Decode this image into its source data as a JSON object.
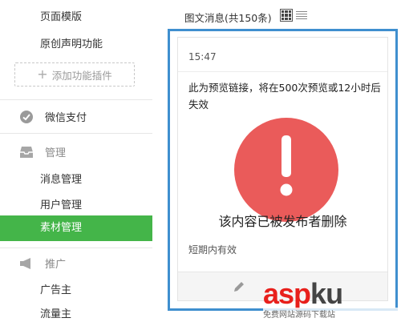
{
  "sidebar": {
    "page_template": "页面模版",
    "original_declaration": "原创声明功能",
    "add_plugin": "添加功能插件",
    "wechat_pay": "微信支付",
    "manage": {
      "heading": "管理",
      "items": [
        "消息管理",
        "用户管理",
        "素材管理"
      ]
    },
    "promote": {
      "heading": "推广",
      "items": [
        "广告主",
        "流量主"
      ]
    }
  },
  "materials": {
    "count_label": "图文消息(共150条)",
    "card": {
      "time": "15:47",
      "notice": "此为预览链接，将在500次预览或12小时后失效",
      "deleted": "该内容已被发布者删除",
      "validity": "短期内有效"
    }
  },
  "watermark": {
    "main_red": "asp",
    "main_gray": "ku",
    "sub": "免费网站源码下载站"
  },
  "colors": {
    "active_green": "#44b549",
    "alert_red": "#ea5b5a",
    "frame_blue": "#3f8fcf"
  }
}
